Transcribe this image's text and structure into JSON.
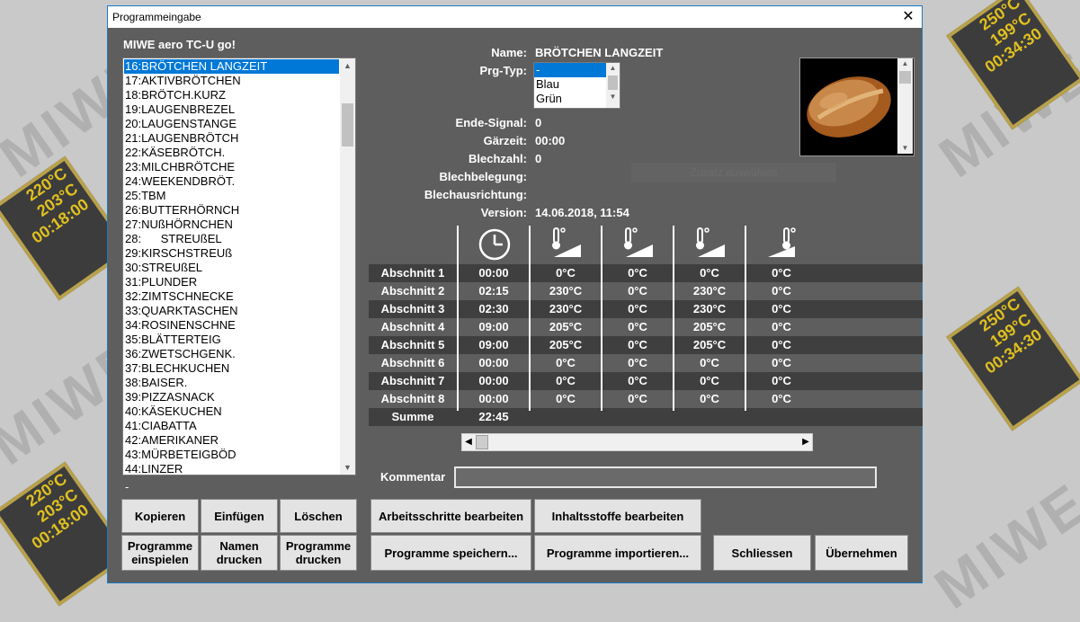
{
  "window": {
    "title": "Programmeingabe",
    "close_glyph": "✕"
  },
  "background": {
    "brand": "MIWE",
    "screen_a": [
      "220°C",
      "203°C",
      "00:18:00"
    ],
    "screen_b": [
      "250°C",
      "199°C",
      "00:34:30"
    ]
  },
  "model_title": "MIWE aero TC-U go!",
  "programs": [
    "16:BRÖTCHEN LANGZEIT",
    "17:AKTIVBRÖTCHEN",
    "18:BRÖTCH.KURZ",
    "19:LAUGENBREZEL",
    "20:LAUGENSTANGE",
    "21:LAUGENBRÖTCH",
    "22:KÄSEBRÖTCH.",
    "23:MILCHBRÖTCHE",
    "24:WEEKENDBRÖT.",
    "25:TBM",
    "26:BUTTERHÖRNCH",
    "27:NUßHÖRNCHEN",
    "28:      STREUßEL",
    "29:KIRSCHSTREUß",
    "30:STREUßEL",
    "31:PLUNDER",
    "32:ZIMTSCHNECKE",
    "33:QUARKTASCHEN",
    "34:ROSINENSCHNE",
    "35:BLÄTTERTEIG",
    "36:ZWETSCHGENK.",
    "37:BLECHKUCHEN",
    "38:BAISER.",
    "39:PIZZASNACK",
    "40:KÄSEKUCHEN",
    "41:CIABATTA",
    "42:AMERIKANER",
    "43:MÜRBETEIGBÖD",
    "44:LINZER"
  ],
  "list_footer": "-",
  "fields": {
    "name_label": "Name:",
    "name_value": "BRÖTCHEN LANGZEIT",
    "prg_label": "Prg-Typ:",
    "prg_options": [
      "-",
      "Blau",
      "Grün"
    ],
    "ende_label": "Ende-Signal:",
    "ende_value": "0",
    "gar_label": "Gärzeit:",
    "gar_value": "00:00",
    "blechzahl_label": "Blechzahl:",
    "blechzahl_value": "0",
    "blechbelegung_label": "Blechbelegung:",
    "blechausrichtung_label": "Blechausrichtung:",
    "version_label": "Version:",
    "version_value": "14.06.2018, 11:54",
    "ghost_button": "Zusatz auswählen"
  },
  "table": {
    "icons": [
      "clock-icon",
      "temperature-ramp-icon",
      "temperature-ramp-icon",
      "temperature-ramp-icon",
      "temperature-ramp-icon"
    ],
    "rows": [
      {
        "label": "Abschnitt 1",
        "time": "00:00",
        "t1": "0°C",
        "t2": "0°C",
        "t3": "0°C",
        "t4": "0°C"
      },
      {
        "label": "Abschnitt 2",
        "time": "02:15",
        "t1": "230°C",
        "t2": "0°C",
        "t3": "230°C",
        "t4": "0°C"
      },
      {
        "label": "Abschnitt 3",
        "time": "02:30",
        "t1": "230°C",
        "t2": "0°C",
        "t3": "230°C",
        "t4": "0°C"
      },
      {
        "label": "Abschnitt 4",
        "time": "09:00",
        "t1": "205°C",
        "t2": "0°C",
        "t3": "205°C",
        "t4": "0°C"
      },
      {
        "label": "Abschnitt 5",
        "time": "09:00",
        "t1": "205°C",
        "t2": "0°C",
        "t3": "205°C",
        "t4": "0°C"
      },
      {
        "label": "Abschnitt 6",
        "time": "00:00",
        "t1": "0°C",
        "t2": "0°C",
        "t3": "0°C",
        "t4": "0°C"
      },
      {
        "label": "Abschnitt 7",
        "time": "00:00",
        "t1": "0°C",
        "t2": "0°C",
        "t3": "0°C",
        "t4": "0°C"
      },
      {
        "label": "Abschnitt 8",
        "time": "00:00",
        "t1": "0°C",
        "t2": "0°C",
        "t3": "0°C",
        "t4": "0°C"
      }
    ],
    "sum_label": "Summe",
    "sum_value": "22:45"
  },
  "comment": {
    "label": "Kommentar",
    "value": ""
  },
  "buttons": {
    "kopieren": "Kopieren",
    "einfuegen": "Einfügen",
    "loeschen": "Löschen",
    "arbeitsschritte": "Arbeitsschritte bearbeiten",
    "inhaltsstoffe": "Inhaltsstoffe bearbeiten",
    "programme_einspielen": "Programme\neinspielen",
    "namen_drucken": "Namen\ndrucken",
    "programme_drucken": "Programme\ndrucken",
    "programme_speichern": "Programme speichern...",
    "programme_importieren": "Programme importieren...",
    "schliessen": "Schliessen",
    "uebernehmen": "Übernehmen"
  }
}
